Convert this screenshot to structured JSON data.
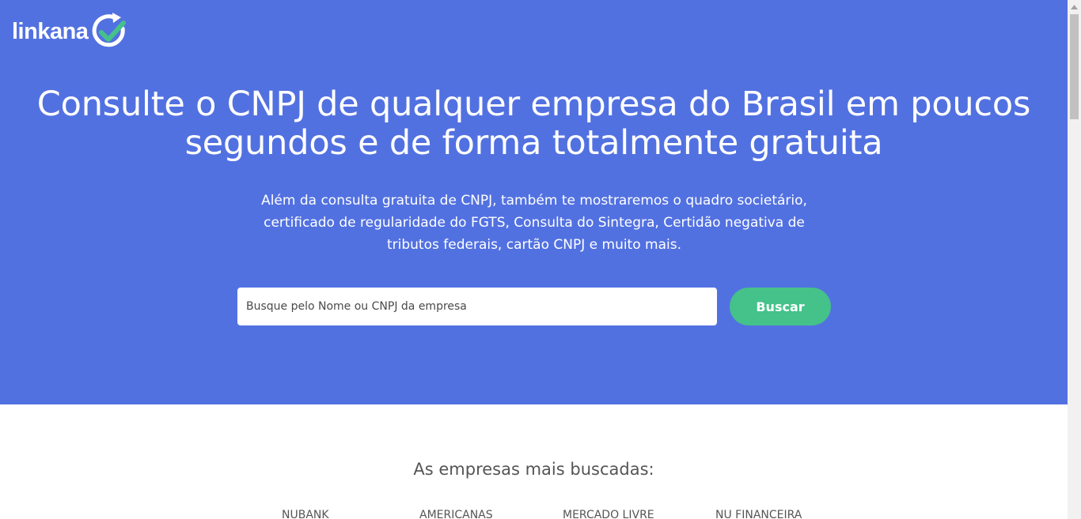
{
  "header": {
    "logo_text": "linkana"
  },
  "hero": {
    "headline_line1": "Consulte o CNPJ de qualquer empresa do Brasil em poucos",
    "headline_line2": "segundos e de forma totalmente gratuita",
    "subtitle_line1": "Além da consulta gratuita de CNPJ, também te mostraremos o quadro societário,",
    "subtitle_line2": "certificado de regularidade do FGTS, Consulta do Sintegra, Certidão negativa de",
    "subtitle_line3": "tributos federais, cartão CNPJ e muito mais.",
    "background_color": "#5271e1"
  },
  "search": {
    "placeholder": "Busque pelo Nome ou CNPJ da empresa",
    "value": "",
    "button_label": "Buscar",
    "button_color": "#45c18a"
  },
  "popular": {
    "title": "As empresas mais buscadas:",
    "companies": [
      "NUBANK",
      "AMERICANAS",
      "MERCADO LIVRE",
      "NU FINANCEIRA"
    ]
  },
  "icons": {
    "logo_mark": "circular-arrow-check-icon",
    "scroll_up": "chevron-up-icon"
  }
}
